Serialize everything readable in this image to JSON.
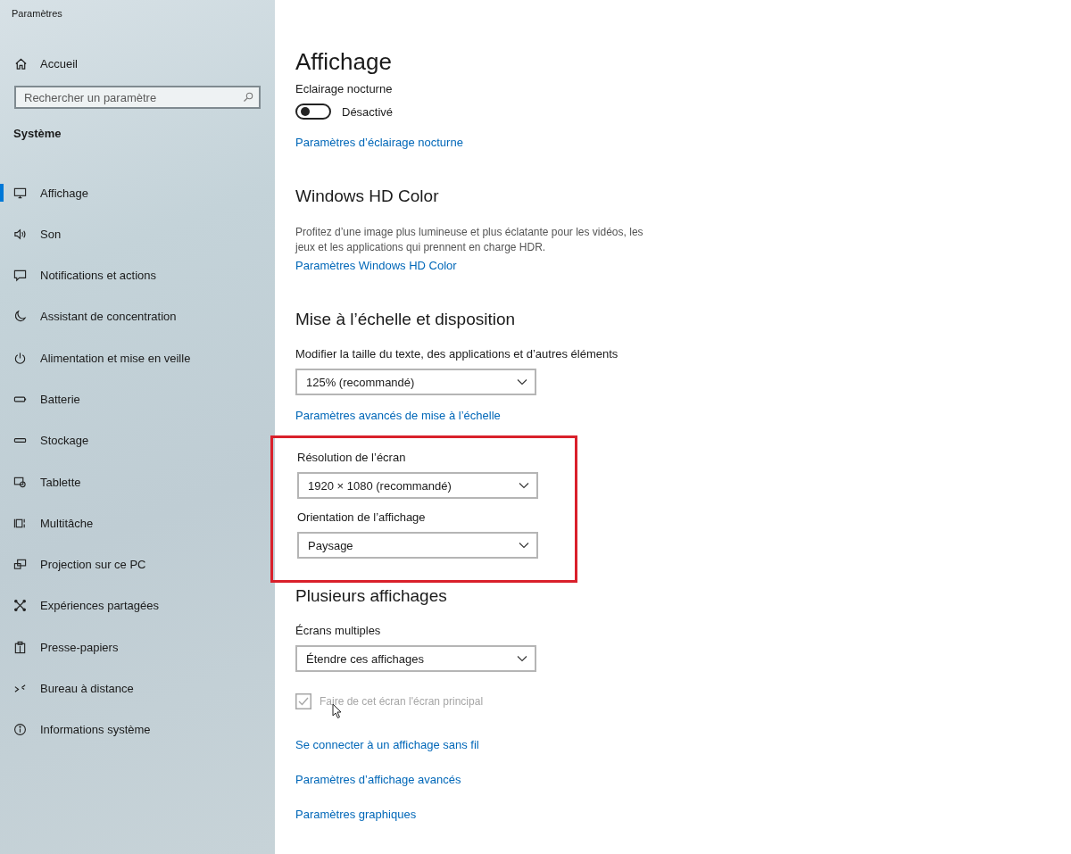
{
  "window": {
    "title": "Paramètres"
  },
  "sidebar": {
    "home": "Accueil",
    "search": {
      "placeholder": "Rechercher un paramètre"
    },
    "section": "Système",
    "items": [
      {
        "label": "Affichage",
        "selected": true
      },
      {
        "label": "Son",
        "selected": false
      },
      {
        "label": "Notifications et actions",
        "selected": false
      },
      {
        "label": "Assistant de concentration",
        "selected": false
      },
      {
        "label": "Alimentation et mise en veille",
        "selected": false
      },
      {
        "label": "Batterie",
        "selected": false
      },
      {
        "label": "Stockage",
        "selected": false
      },
      {
        "label": "Tablette",
        "selected": false
      },
      {
        "label": "Multitâche",
        "selected": false
      },
      {
        "label": "Projection sur ce PC",
        "selected": false
      },
      {
        "label": "Expériences partagées",
        "selected": false
      },
      {
        "label": "Presse-papiers",
        "selected": false
      },
      {
        "label": "Bureau à distance",
        "selected": false
      },
      {
        "label": "Informations système",
        "selected": false
      }
    ]
  },
  "page": {
    "title": "Affichage",
    "night_light": {
      "label": "Eclairage nocturne",
      "toggle": {
        "on": false,
        "state": "Désactivé"
      },
      "link": "Paramètres d’éclairage nocturne"
    },
    "hd_color": {
      "heading": "Windows HD Color",
      "description": "Profitez d’une image plus lumineuse et plus éclatante pour les vidéos, les jeux et les applications qui prennent en charge HDR.",
      "link": "Paramètres Windows HD Color"
    },
    "scaling": {
      "heading": "Mise à l’échelle et disposition",
      "size_label": "Modifier la taille du texte, des applications et d’autres éléments",
      "size_value": "125% (recommandé)",
      "link": "Paramètres avancés de mise à l’échelle",
      "highlighted": true,
      "resolution_label": "Résolution de l’écran",
      "resolution_value": "1920 × 1080 (recommandé)",
      "orientation_label": "Orientation de l’affichage",
      "orientation_value": "Paysage"
    },
    "multiple": {
      "heading": "Plusieurs affichages",
      "label": "Écrans multiples",
      "value": "Étendre ces affichages",
      "checkbox": {
        "label": "Faire de cet écran l'écran principal",
        "checked": true,
        "disabled": true
      },
      "links": [
        "Se connecter à un affichage sans fil",
        "Paramètres d’affichage avancés",
        "Paramètres graphiques"
      ]
    }
  }
}
